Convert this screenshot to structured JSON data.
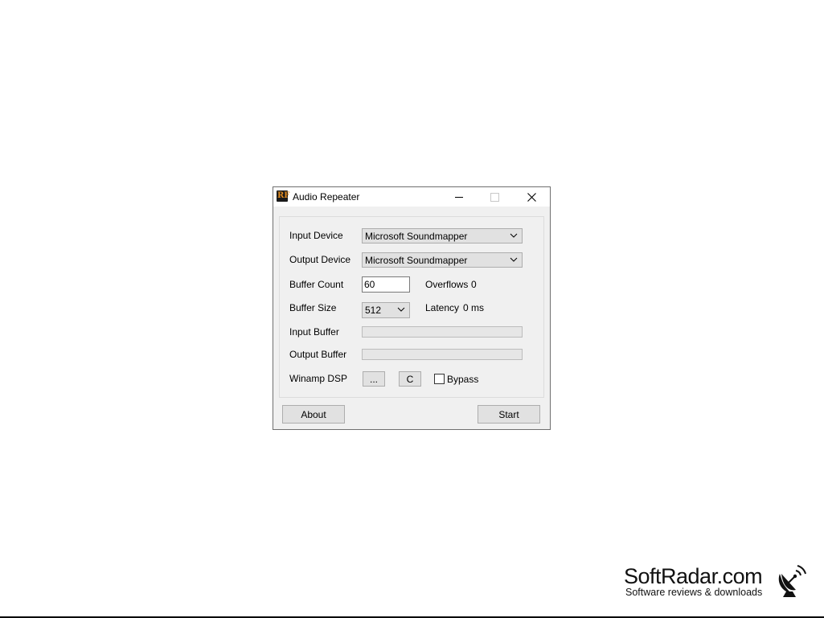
{
  "window": {
    "title": "Audio Repeater",
    "icon": "app-logo-icon",
    "icon_glyph": "RF"
  },
  "form": {
    "input_device_label": "Input Device",
    "input_device_value": "Microsoft Soundmapper",
    "output_device_label": "Output Device",
    "output_device_value": "Microsoft Soundmapper",
    "buffer_count_label": "Buffer Count",
    "buffer_count_value": "60",
    "overflows_label": "Overflows",
    "overflows_value": "0",
    "buffer_size_label": "Buffer Size",
    "buffer_size_value": "512",
    "latency_label": "Latency",
    "latency_value": "0 ms",
    "input_buffer_label": "Input Buffer",
    "input_buffer_percent": 0,
    "output_buffer_label": "Output Buffer",
    "output_buffer_percent": 0,
    "winamp_dsp_label": "Winamp DSP",
    "dsp_browse_label": "...",
    "dsp_config_label": "C",
    "bypass_label": "Bypass",
    "bypass_checked": false
  },
  "footer": {
    "about_label": "About",
    "start_label": "Start"
  },
  "watermark": {
    "brand": "SoftRadar.com",
    "tagline": "Software reviews & downloads",
    "icon": "satellite-dish-icon"
  },
  "colors": {
    "window_bg": "#f0f0f0",
    "button_bg": "#e1e1e1",
    "progress_fill": "#06b025"
  }
}
